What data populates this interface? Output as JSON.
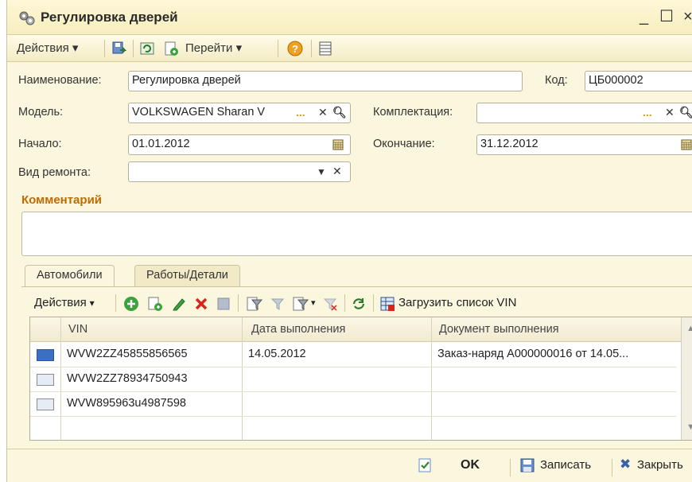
{
  "window": {
    "title": "Регулировка дверей"
  },
  "toolbar": {
    "actions": "Действия",
    "goto": "Перейти"
  },
  "form": {
    "name_label": "Наименование:",
    "name_value": "Регулировка дверей",
    "code_label": "Код:",
    "code_value": "ЦБ000002",
    "model_label": "Модель:",
    "model_value": "VOLKSWAGEN Sharan V",
    "equipment_label": "Комплектация:",
    "equipment_value": "",
    "start_label": "Начало:",
    "start_value": "01.01.2012",
    "end_label": "Окончание:",
    "end_value": "31.12.2012",
    "repair_type_label": "Вид ремонта:",
    "repair_type_value": "",
    "comment_label": "Комментарий",
    "comment_value": ""
  },
  "tabs": [
    "Автомобили",
    "Работы/Детали"
  ],
  "subtoolbar": {
    "actions": "Действия",
    "load_vin": "Загрузить список VIN"
  },
  "table": {
    "columns": [
      "VIN",
      "Дата выполнения",
      "Документ выполнения"
    ],
    "rows": [
      {
        "vin": "WVW2ZZ45855856565",
        "date": "14.05.2012",
        "doc": "Заказ-наряд А000000016 от 14.05..."
      },
      {
        "vin": "WVW2ZZ78934750943",
        "date": "",
        "doc": ""
      },
      {
        "vin": "WVW895963u4987598",
        "date": "",
        "doc": ""
      }
    ]
  },
  "footer": {
    "ok": "OK",
    "save": "Записать",
    "close": "Закрыть"
  }
}
